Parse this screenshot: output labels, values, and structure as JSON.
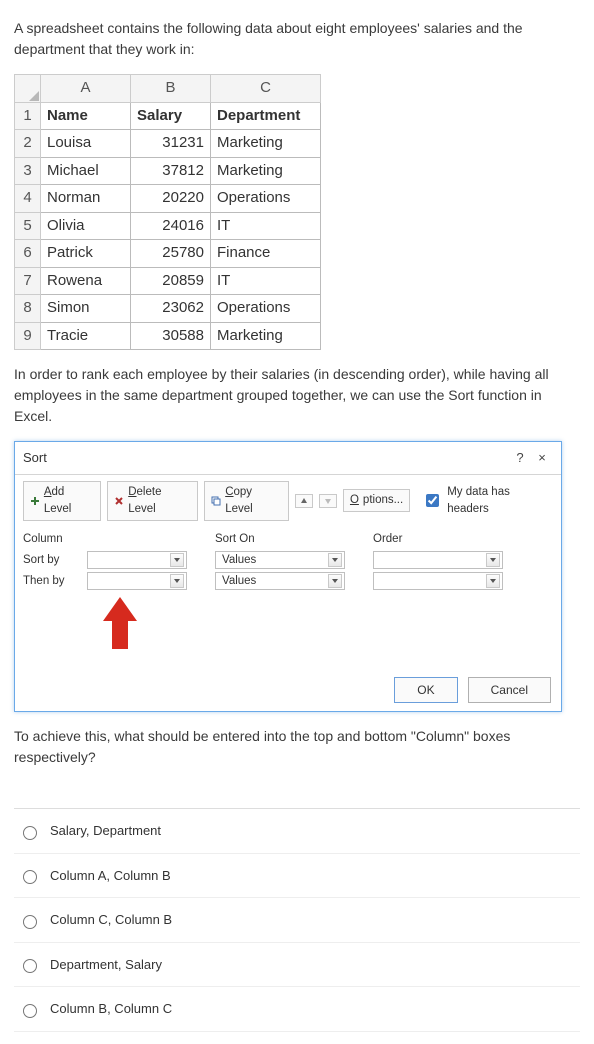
{
  "intro": "A spreadsheet contains the following data about eight employees' salaries and the department that they work in:",
  "table": {
    "cols": [
      "A",
      "B",
      "C"
    ],
    "rows": [
      {
        "n": "1",
        "a": "Name",
        "b": "Salary",
        "c": "Department",
        "header": true
      },
      {
        "n": "2",
        "a": "Louisa",
        "b": "31231",
        "c": "Marketing"
      },
      {
        "n": "3",
        "a": "Michael",
        "b": "37812",
        "c": "Marketing"
      },
      {
        "n": "4",
        "a": "Norman",
        "b": "20220",
        "c": "Operations"
      },
      {
        "n": "5",
        "a": "Olivia",
        "b": "24016",
        "c": "IT"
      },
      {
        "n": "6",
        "a": "Patrick",
        "b": "25780",
        "c": "Finance"
      },
      {
        "n": "7",
        "a": "Rowena",
        "b": "20859",
        "c": "IT"
      },
      {
        "n": "8",
        "a": "Simon",
        "b": "23062",
        "c": "Operations"
      },
      {
        "n": "9",
        "a": "Tracie",
        "b": "30588",
        "c": "Marketing"
      }
    ]
  },
  "mid_text": "In order to rank each employee by their salaries (in descending order), while having all employees in the same department grouped together, we can use the Sort function in Excel.",
  "dialog": {
    "title": "Sort",
    "help": "?",
    "close": "×",
    "add_level": "Add Level",
    "delete_level": "Delete Level",
    "copy_level": "Copy Level",
    "options": "Options...",
    "headers_label_pre": "My data has ",
    "headers_label_u": "h",
    "headers_label_post": "eaders",
    "col_header": "Column",
    "sorton_header": "Sort On",
    "order_header": "Order",
    "rows": [
      {
        "label": "Sort by",
        "sorton": "Values"
      },
      {
        "label": "Then by",
        "sorton": "Values"
      }
    ],
    "ok": "OK",
    "cancel": "Cancel"
  },
  "question": "To achieve this, what should be entered into the top and bottom \"Column\" boxes respectively?",
  "answers": [
    "Salary, Department",
    "Column A, Column B",
    "Column C, Column B",
    "Department, Salary",
    "Column B, Column C"
  ]
}
